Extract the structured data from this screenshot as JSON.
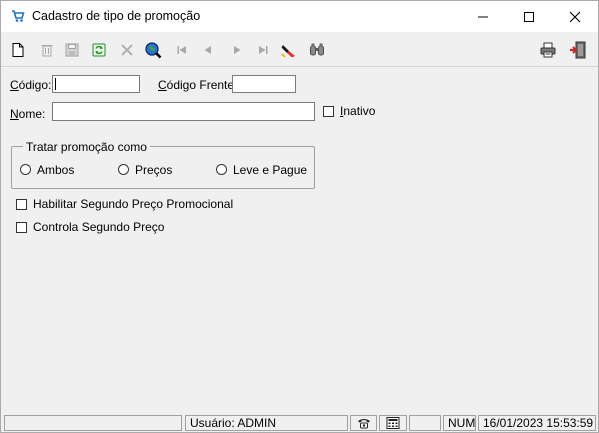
{
  "window": {
    "title": "Cadastro de tipo de promoção"
  },
  "toolbar": {
    "buttons": [
      "new-document",
      "delete",
      "save",
      "refresh",
      "cancel",
      "search",
      "first-record",
      "previous-record",
      "next-record",
      "last-record",
      "clear-filter",
      "find"
    ],
    "right_buttons": [
      "print",
      "exit"
    ]
  },
  "form": {
    "codigo_label": "Código:",
    "codigo_value": "",
    "codigo_frente_label": "Código Frente:",
    "codigo_frente_value": "",
    "nome_label": "Nome:",
    "nome_value": "",
    "inativo_label": "Inativo",
    "inativo_checked": false
  },
  "tratar": {
    "legend": "Tratar promoção como",
    "options": [
      {
        "label": "Ambos",
        "checked": false
      },
      {
        "label": "Preços",
        "checked": false
      },
      {
        "label": "Leve e Pague",
        "checked": false
      }
    ]
  },
  "checkboxes": {
    "habilitar_label": "Habilitar Segundo Preço Promocional",
    "habilitar_checked": false,
    "controla_label": "Controla Segundo Preço",
    "controla_checked": false
  },
  "status": {
    "usuario": "Usuário: ADMIN",
    "num": "NUM",
    "datetime": "16/01/2023 15:53:59"
  },
  "colors": {
    "window_bg": "#f0f0f0",
    "titlebar_bg": "#ffffff",
    "icon_blue": "#1e73be"
  }
}
